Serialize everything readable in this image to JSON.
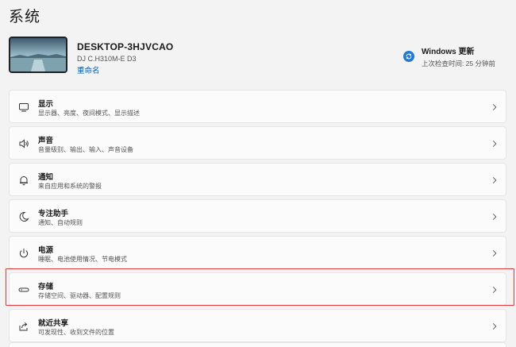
{
  "page": {
    "title": "系统"
  },
  "device": {
    "name": "DESKTOP-3HJVCAO",
    "model": "DJ C.H310M-E D3",
    "rename_label": "重命名"
  },
  "windows_update": {
    "title": "Windows 更新",
    "subtitle": "上次检查时间: 25 分钟前",
    "icon": "sync-icon",
    "accent": "#1f7bd1"
  },
  "settings": [
    {
      "id": "display",
      "icon": "monitor-icon",
      "label": "显示",
      "desc": "显示器、亮度、夜间模式、显示描述"
    },
    {
      "id": "sound",
      "icon": "speaker-icon",
      "label": "声音",
      "desc": "音量级别、输出、输入、声音设备"
    },
    {
      "id": "notifications",
      "icon": "bell-icon",
      "label": "通知",
      "desc": "来自应用和系统的警报"
    },
    {
      "id": "focus-assist",
      "icon": "moon-icon",
      "label": "专注助手",
      "desc": "通知、自动规则"
    },
    {
      "id": "power",
      "icon": "power-icon",
      "label": "电源",
      "desc": "睡眠、电池使用情况、节电模式"
    },
    {
      "id": "storage",
      "icon": "storage-icon",
      "label": "存储",
      "desc": "存储空间、驱动器、配置规则"
    },
    {
      "id": "nearby-sharing",
      "icon": "share-icon",
      "label": "就近共享",
      "desc": "可发现性、收到文件的位置"
    }
  ],
  "highlight_color": "#e53935"
}
